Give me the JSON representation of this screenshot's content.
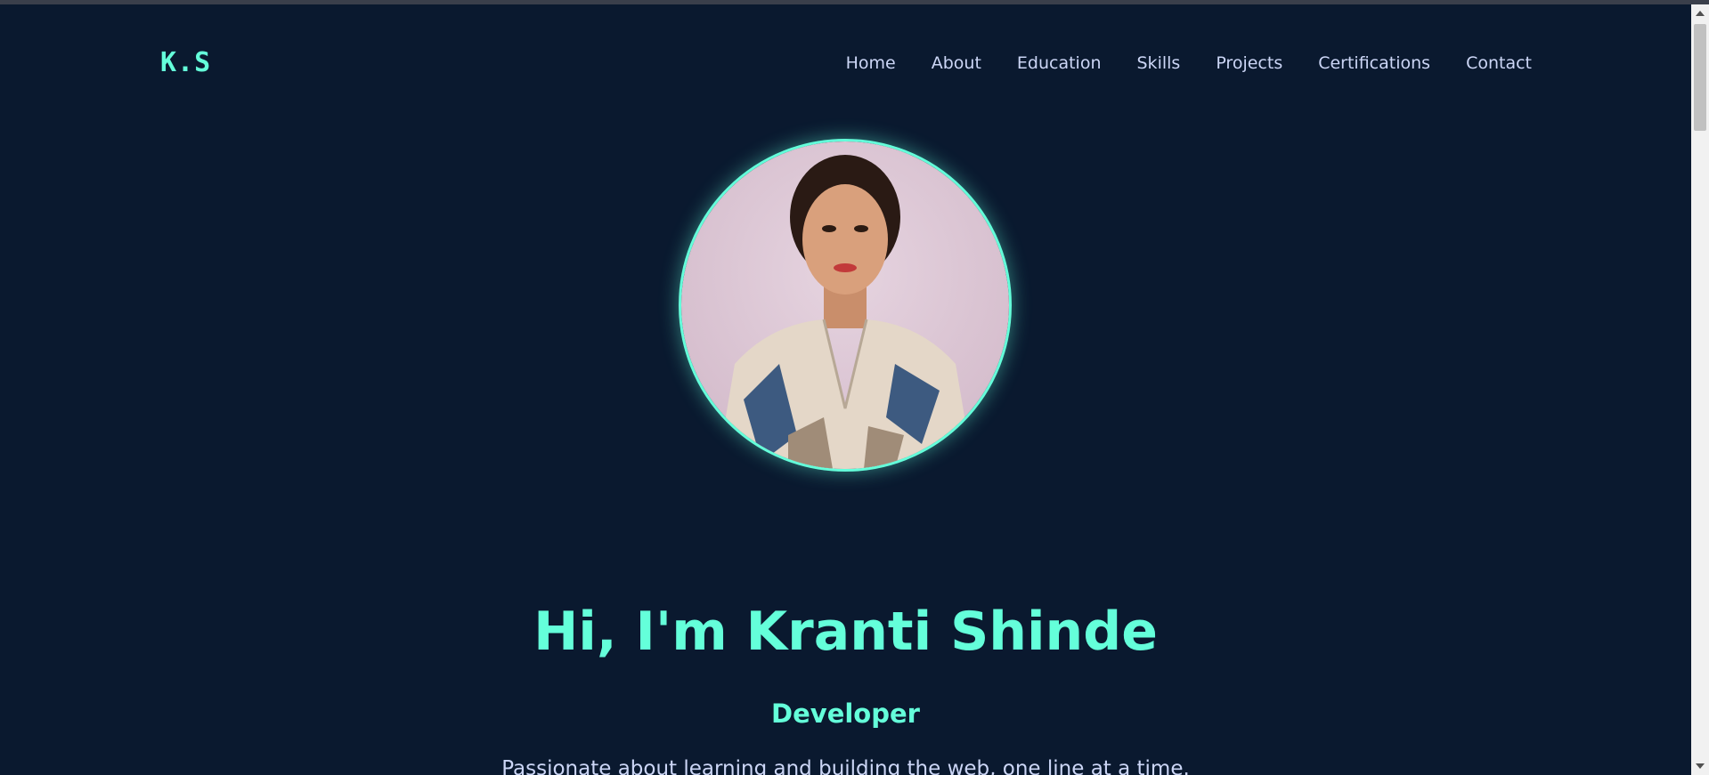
{
  "logo": "K.S",
  "nav": {
    "items": [
      "Home",
      "About",
      "Education",
      "Skills",
      "Projects",
      "Certifications",
      "Contact"
    ]
  },
  "hero": {
    "title": "Hi, I'm Kranti Shinde",
    "role": "Developer",
    "tagline": "Passionate about learning and building the web, one line at a time."
  },
  "colors": {
    "background": "#0a192f",
    "accent": "#64ffda",
    "text": "#ccd6f6"
  }
}
